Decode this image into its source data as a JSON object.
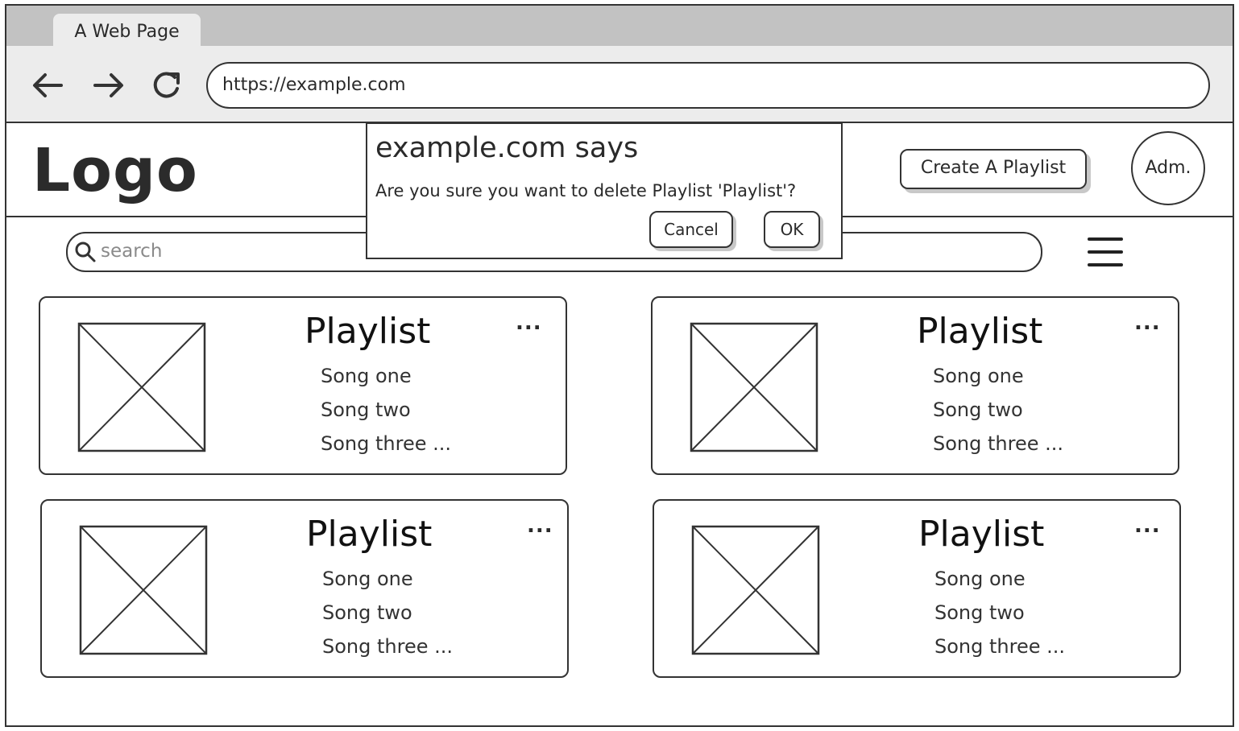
{
  "browser": {
    "tab_title": "A Web Page",
    "url": "https://example.com"
  },
  "header": {
    "logo": "Logo",
    "create_button": "Create A Playlist",
    "avatar": "Adm."
  },
  "search": {
    "placeholder": "search"
  },
  "playlists": [
    {
      "title": "Playlist",
      "songs": [
        "Song one",
        "Song two",
        "Song three ..."
      ],
      "more": "..."
    },
    {
      "title": "Playlist",
      "songs": [
        "Song one",
        "Song two",
        "Song three ..."
      ],
      "more": "..."
    },
    {
      "title": "Playlist",
      "songs": [
        "Song one",
        "Song two",
        "Song three ..."
      ],
      "more": "..."
    },
    {
      "title": "Playlist",
      "songs": [
        "Song one",
        "Song two",
        "Song three ..."
      ],
      "more": "..."
    }
  ],
  "dialog": {
    "title": "example.com says",
    "message": "Are you sure you want to delete Playlist 'Playlist'?",
    "cancel": "Cancel",
    "ok": "OK"
  }
}
